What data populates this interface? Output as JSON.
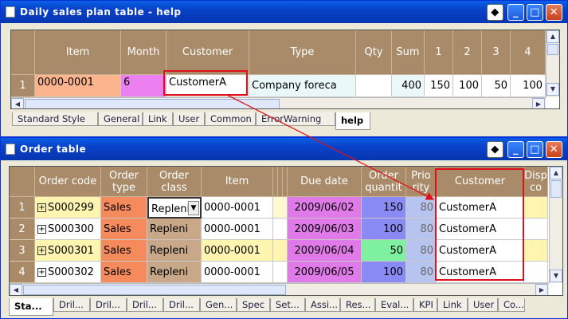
{
  "help_window": {
    "title": "Daily sales plan table - help",
    "columns": [
      "Item",
      "Month",
      "Customer",
      "Type",
      "Qty",
      "Sum",
      "1",
      "2",
      "3",
      "4"
    ],
    "row": {
      "num": "1",
      "item": "0000-0001",
      "month": "6",
      "customer": "CustomerA",
      "type": "Company foreca",
      "qty": "",
      "sum": "400",
      "d1": "150",
      "d2": "100",
      "d3": "50",
      "d4": "100"
    },
    "tabs": [
      "Standard Style",
      "General",
      "Link",
      "User",
      "Common",
      "ErrorWarning",
      "help"
    ],
    "active_tab": "help"
  },
  "order_window": {
    "title": "Order table",
    "columns": {
      "order_code": "Order code",
      "order_type": "Order type",
      "order_class": "Order class",
      "item": "Item",
      "due_date": "Due date",
      "order_quantity": "Order quantit",
      "priority": "Prio rity",
      "customer": "Customer",
      "disp": "Disp co"
    },
    "rows": [
      {
        "num": "1",
        "code": "S000299",
        "type": "Sales",
        "class": "Repleni",
        "item": "0000-0001",
        "due": "2009/06/02",
        "qty": "150",
        "prio": "80",
        "customer": "CustomerA"
      },
      {
        "num": "2",
        "code": "S000300",
        "type": "Sales",
        "class": "Repleni",
        "item": "0000-0001",
        "due": "2009/06/03",
        "qty": "100",
        "prio": "80",
        "customer": "CustomerA"
      },
      {
        "num": "3",
        "code": "S000301",
        "type": "Sales",
        "class": "Repleni",
        "item": "0000-0001",
        "due": "2009/06/04",
        "qty": "50",
        "prio": "80",
        "customer": "CustomerA"
      },
      {
        "num": "4",
        "code": "S000302",
        "type": "Sales",
        "class": "Repleni",
        "item": "0000-0001",
        "due": "2009/06/05",
        "qty": "100",
        "prio": "80",
        "customer": "CustomerA"
      }
    ],
    "tabs": [
      "Sta...",
      "Dril...",
      "Dril...",
      "Dril...",
      "Dril...",
      "Gen...",
      "Spec",
      "Set...",
      "Assi...",
      "Res...",
      "Eval...",
      "KPI",
      "Link",
      "User",
      "Co..."
    ],
    "active_tab": "Sta..."
  },
  "icons": {
    "restore": "diamond-icon",
    "minimize": "minimize-icon",
    "maximize": "maximize-icon",
    "close": "close-icon"
  },
  "colors": {
    "header": "#a98b69",
    "title_bar": "#0841c8",
    "highlight": "#e0101a"
  }
}
